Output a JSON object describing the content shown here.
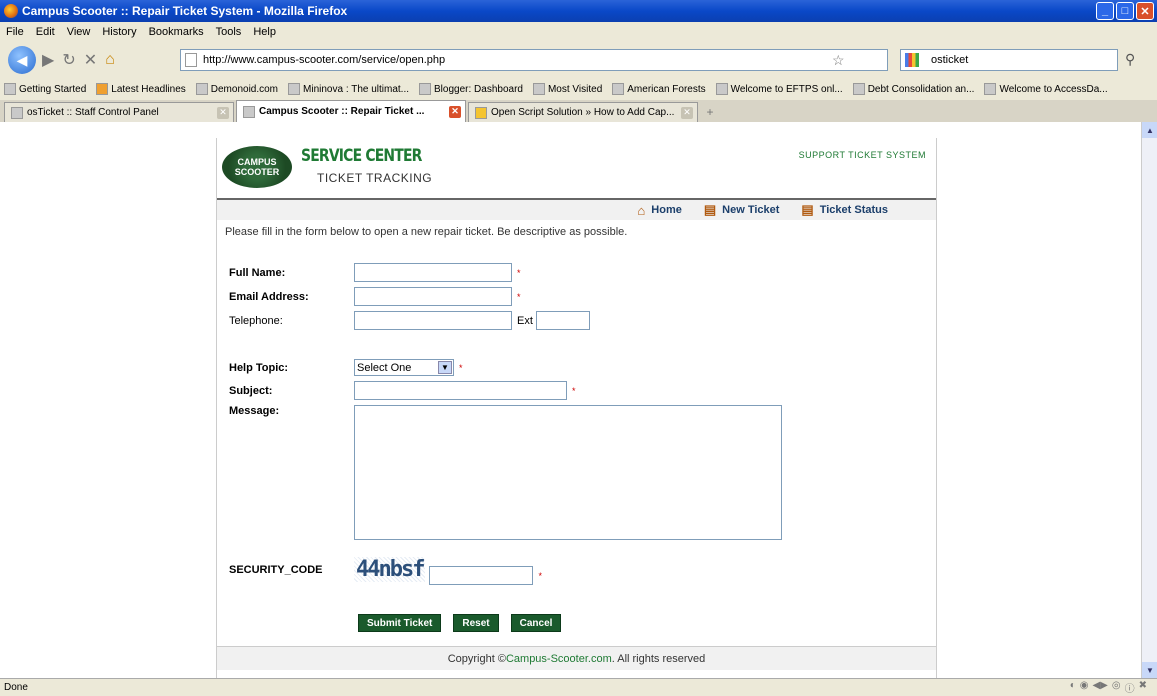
{
  "window": {
    "title": "Campus Scooter :: Repair Ticket System - Mozilla Firefox"
  },
  "menu": [
    "File",
    "Edit",
    "View",
    "History",
    "Bookmarks",
    "Tools",
    "Help"
  ],
  "nav": {
    "url": "http://www.campus-scooter.com/service/open.php",
    "search": "osticket"
  },
  "bookmarks": [
    "Getting Started",
    "Latest Headlines",
    "Demonoid.com",
    "Mininova : The ultimat...",
    "Blogger: Dashboard",
    "Most Visited",
    "American Forests",
    "Welcome to EFTPS onl...",
    "Debt Consolidation an...",
    "Welcome to AccessDa..."
  ],
  "tabs": [
    "osTicket :: Staff Control Panel",
    "Campus Scooter :: Repair Ticket ...",
    "Open Script Solution » How to Add Cap..."
  ],
  "status": "Done",
  "page": {
    "logo_text": "CAMPUS SCOOTER",
    "brand": "SERVICE CENTER",
    "tracking": "TICKET TRACKING",
    "support": "SUPPORT TICKET SYSTEM",
    "nav_home": "Home",
    "nav_new": "New Ticket",
    "nav_status": "Ticket Status",
    "intro": "Please fill in the form below to open a new repair ticket. Be descriptive as possible.",
    "full_name_label": "Full Name:",
    "email_label": "Email Address:",
    "phone_label": "Telephone:",
    "ext_label": "Ext",
    "topic_label": "Help Topic:",
    "topic_value": "Select One",
    "subject_label": "Subject:",
    "message_label": "Message:",
    "security_label": "SECURITY_CODE",
    "captcha": "44nbsf",
    "submit": "Submit Ticket",
    "reset": "Reset",
    "cancel": "Cancel",
    "copyright_pre": "Copyright © ",
    "copyright_link": "Campus-Scooter.com",
    "copyright_post": ". All rights reserved"
  }
}
